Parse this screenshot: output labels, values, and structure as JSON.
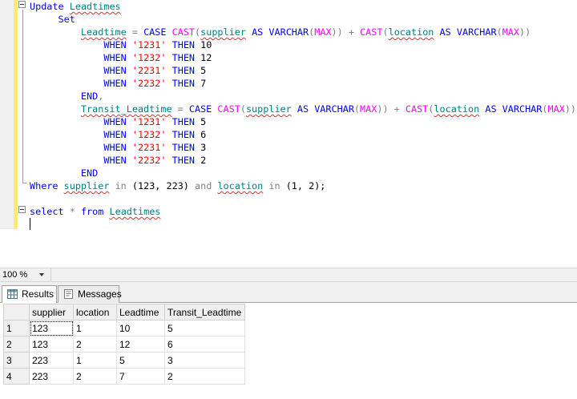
{
  "editor": {
    "lines": [
      [
        {
          "t": "Update",
          "c": "kw"
        },
        {
          "t": " "
        },
        {
          "t": "Leadtimes",
          "c": "id"
        }
      ],
      [
        {
          "t": "     "
        },
        {
          "t": "Set",
          "c": "kw"
        }
      ],
      [
        {
          "t": "         "
        },
        {
          "t": "Leadtime",
          "c": "id"
        },
        {
          "t": " = ",
          "c": "gry"
        },
        {
          "t": "CASE",
          "c": "kw"
        },
        {
          "t": " "
        },
        {
          "t": "CAST",
          "c": "fn"
        },
        {
          "t": "(",
          "c": "gry"
        },
        {
          "t": "supplier",
          "c": "id"
        },
        {
          "t": " "
        },
        {
          "t": "AS",
          "c": "kw"
        },
        {
          "t": " "
        },
        {
          "t": "VARCHAR",
          "c": "kw"
        },
        {
          "t": "(",
          "c": "gry"
        },
        {
          "t": "MAX",
          "c": "fn"
        },
        {
          "t": "))",
          "c": "gry"
        },
        {
          "t": " + ",
          "c": "gry"
        },
        {
          "t": "CAST",
          "c": "fn"
        },
        {
          "t": "(",
          "c": "gry"
        },
        {
          "t": "location",
          "c": "id"
        },
        {
          "t": " "
        },
        {
          "t": "AS",
          "c": "kw"
        },
        {
          "t": " "
        },
        {
          "t": "VARCHAR",
          "c": "kw"
        },
        {
          "t": "(",
          "c": "gry"
        },
        {
          "t": "MAX",
          "c": "fn"
        },
        {
          "t": "))",
          "c": "gry"
        }
      ],
      [
        {
          "t": "             "
        },
        {
          "t": "WHEN",
          "c": "kw"
        },
        {
          "t": " "
        },
        {
          "t": "'1231'",
          "c": "str"
        },
        {
          "t": " "
        },
        {
          "t": "THEN",
          "c": "kw"
        },
        {
          "t": " 10"
        }
      ],
      [
        {
          "t": "             "
        },
        {
          "t": "WHEN",
          "c": "kw"
        },
        {
          "t": " "
        },
        {
          "t": "'1232'",
          "c": "str"
        },
        {
          "t": " "
        },
        {
          "t": "THEN",
          "c": "kw"
        },
        {
          "t": " 12"
        }
      ],
      [
        {
          "t": "             "
        },
        {
          "t": "WHEN",
          "c": "kw"
        },
        {
          "t": " "
        },
        {
          "t": "'2231'",
          "c": "str"
        },
        {
          "t": " "
        },
        {
          "t": "THEN",
          "c": "kw"
        },
        {
          "t": " 5"
        }
      ],
      [
        {
          "t": "             "
        },
        {
          "t": "WHEN",
          "c": "kw"
        },
        {
          "t": " "
        },
        {
          "t": "'2232'",
          "c": "str"
        },
        {
          "t": " "
        },
        {
          "t": "THEN",
          "c": "kw"
        },
        {
          "t": " 7"
        }
      ],
      [
        {
          "t": "         "
        },
        {
          "t": "END",
          "c": "kw"
        },
        {
          "t": ",",
          "c": "gry"
        }
      ],
      [
        {
          "t": "         "
        },
        {
          "t": "Transit_Leadtime",
          "c": "id"
        },
        {
          "t": " = ",
          "c": "gry"
        },
        {
          "t": "CASE",
          "c": "kw"
        },
        {
          "t": " "
        },
        {
          "t": "CAST",
          "c": "fn"
        },
        {
          "t": "(",
          "c": "gry"
        },
        {
          "t": "supplier",
          "c": "id"
        },
        {
          "t": " "
        },
        {
          "t": "AS",
          "c": "kw"
        },
        {
          "t": " "
        },
        {
          "t": "VARCHAR",
          "c": "kw"
        },
        {
          "t": "(",
          "c": "gry"
        },
        {
          "t": "MAX",
          "c": "fn"
        },
        {
          "t": "))",
          "c": "gry"
        },
        {
          "t": " + ",
          "c": "gry"
        },
        {
          "t": "CAST",
          "c": "fn"
        },
        {
          "t": "(",
          "c": "gry"
        },
        {
          "t": "location",
          "c": "id"
        },
        {
          "t": " "
        },
        {
          "t": "AS",
          "c": "kw"
        },
        {
          "t": " "
        },
        {
          "t": "VARCHAR",
          "c": "kw"
        },
        {
          "t": "(",
          "c": "gry"
        },
        {
          "t": "MAX",
          "c": "fn"
        },
        {
          "t": "))",
          "c": "gry"
        }
      ],
      [
        {
          "t": "             "
        },
        {
          "t": "WHEN",
          "c": "kw"
        },
        {
          "t": " "
        },
        {
          "t": "'1231'",
          "c": "str"
        },
        {
          "t": " "
        },
        {
          "t": "THEN",
          "c": "kw"
        },
        {
          "t": " 5"
        }
      ],
      [
        {
          "t": "             "
        },
        {
          "t": "WHEN",
          "c": "kw"
        },
        {
          "t": " "
        },
        {
          "t": "'1232'",
          "c": "str"
        },
        {
          "t": " "
        },
        {
          "t": "THEN",
          "c": "kw"
        },
        {
          "t": " 6"
        }
      ],
      [
        {
          "t": "             "
        },
        {
          "t": "WHEN",
          "c": "kw"
        },
        {
          "t": " "
        },
        {
          "t": "'2231'",
          "c": "str"
        },
        {
          "t": " "
        },
        {
          "t": "THEN",
          "c": "kw"
        },
        {
          "t": " 3"
        }
      ],
      [
        {
          "t": "             "
        },
        {
          "t": "WHEN",
          "c": "kw"
        },
        {
          "t": " "
        },
        {
          "t": "'2232'",
          "c": "str"
        },
        {
          "t": " "
        },
        {
          "t": "THEN",
          "c": "kw"
        },
        {
          "t": " 2"
        }
      ],
      [
        {
          "t": "         "
        },
        {
          "t": "END",
          "c": "kw"
        }
      ],
      [
        {
          "t": "Where",
          "c": "kw"
        },
        {
          "t": " "
        },
        {
          "t": "supplier",
          "c": "id"
        },
        {
          "t": " "
        },
        {
          "t": "in",
          "c": "gry"
        },
        {
          "t": " (123, 223) "
        },
        {
          "t": "and",
          "c": "gry"
        },
        {
          "t": " "
        },
        {
          "t": "location",
          "c": "id"
        },
        {
          "t": " "
        },
        {
          "t": "in",
          "c": "gry"
        },
        {
          "t": " (1, 2);"
        }
      ],
      [],
      [
        {
          "t": "select",
          "c": "kw"
        },
        {
          "t": " "
        },
        {
          "t": "*",
          "c": "gry"
        },
        {
          "t": " "
        },
        {
          "t": "from",
          "c": "kw"
        },
        {
          "t": " "
        },
        {
          "t": "Leadtimes",
          "c": "id"
        }
      ],
      []
    ]
  },
  "zoom": {
    "value": "100 %"
  },
  "tabs": [
    {
      "label": "Results",
      "icon": "grid-icon",
      "active": true
    },
    {
      "label": "Messages",
      "icon": "messages-icon",
      "active": false
    }
  ],
  "results": {
    "columns": [
      "supplier",
      "location",
      "Leadtime",
      "Transit_Leadtime"
    ],
    "rows": [
      {
        "n": "1",
        "cells": [
          "123",
          "1",
          "10",
          "5"
        ]
      },
      {
        "n": "2",
        "cells": [
          "123",
          "2",
          "12",
          "6"
        ]
      },
      {
        "n": "3",
        "cells": [
          "223",
          "1",
          "5",
          "3"
        ]
      },
      {
        "n": "4",
        "cells": [
          "223",
          "2",
          "7",
          "2"
        ]
      }
    ]
  },
  "colors": {
    "keyword": "#0000ff",
    "function": "#ff00ff",
    "string": "#ff0000",
    "operator": "#808080",
    "identifier": "#008080",
    "change_bar": "#ffee62"
  }
}
